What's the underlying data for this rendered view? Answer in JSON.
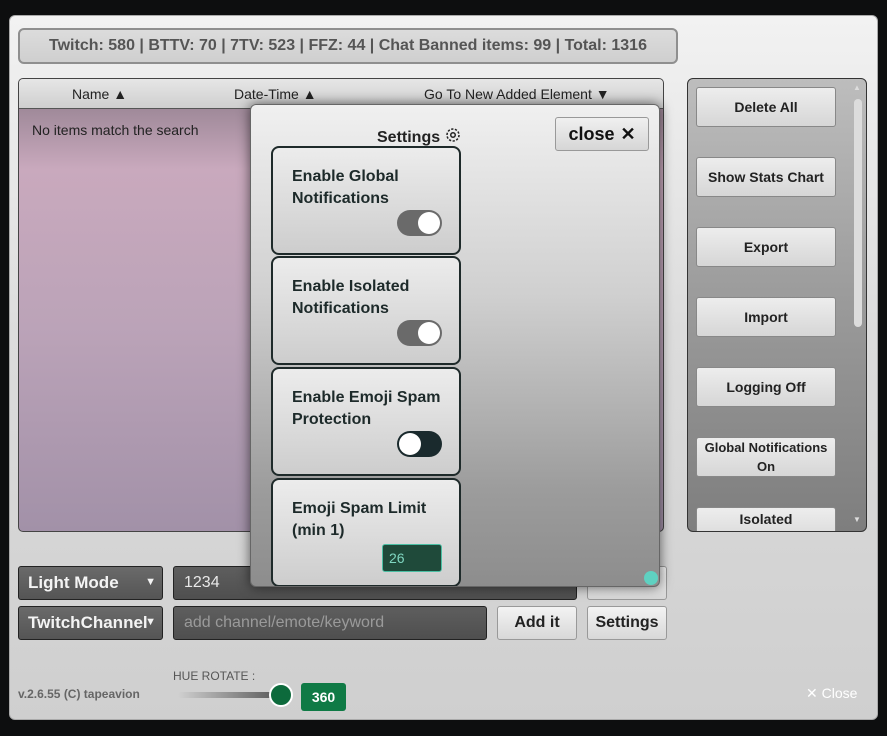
{
  "stats": "Twitch: 580 | BTTV: 70 | 7TV: 523 | FFZ: 44 | Chat Banned items: 99 | Total: 1316",
  "list": {
    "columns": [
      "Name ▲",
      "Date-Time ▲",
      "Go To New Added Element ▼"
    ],
    "empty_text": "No items match the search"
  },
  "sidebar": {
    "buttons": [
      "Delete All",
      "Show Stats Chart",
      "Export",
      "Import",
      "Logging Off",
      "Global Notifications On",
      "Isolated"
    ]
  },
  "controls": {
    "mode_select": "Light Mode",
    "search_value": "1234",
    "type_select": "TwitchChannel",
    "add_placeholder": "add channel/emote/keyword",
    "add_button": "Add it",
    "settings_button": "Settings"
  },
  "footer": {
    "version": "v.2.6.55 (C) tapeavion",
    "hue_label": "HUE ROTATE :",
    "hue_value": "360",
    "close": "Close"
  },
  "settings": {
    "title": "Settings",
    "close": "close",
    "options": [
      {
        "label": "Enable Global Notifications",
        "state": "on"
      },
      {
        "label": "Enable Isolated Notifications",
        "state": "on"
      },
      {
        "label": "Enable Emoji Spam Protection",
        "state": "off"
      },
      {
        "label": "Emoji Spam Limit (min 1)",
        "value": "26"
      }
    ]
  },
  "icons": {
    "settings": "gear-icon",
    "close": "x-icon",
    "select_arrow": "chevron-down-icon"
  },
  "colors": {
    "accent_green": "#0f7a45",
    "teal": "#5fd1c1"
  }
}
